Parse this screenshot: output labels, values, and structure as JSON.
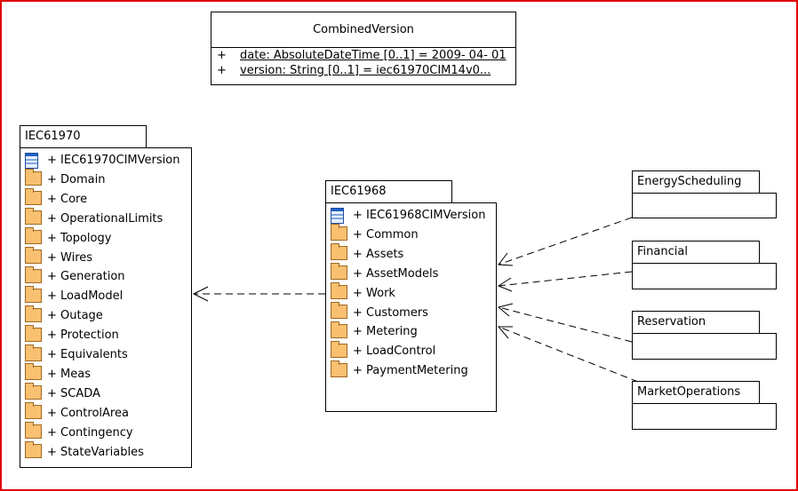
{
  "combined_version": {
    "title": "CombinedVersion",
    "attributes": [
      {
        "visibility": "+",
        "text": "date:  AbsoluteDateTime [0..1] = 2009- 04- 01"
      },
      {
        "visibility": "+",
        "text": "version:  String [0..1] = iec61970CIM14v0..."
      }
    ]
  },
  "iec61970": {
    "name": "IEC61970",
    "items": [
      {
        "label": "+ IEC61970CIMVersion",
        "icon": "class-icon"
      },
      {
        "label": "+ Domain",
        "icon": "folder-icon"
      },
      {
        "label": "+ Core",
        "icon": "folder-icon"
      },
      {
        "label": "+ OperationalLimits",
        "icon": "folder-icon"
      },
      {
        "label": "+ Topology",
        "icon": "folder-icon"
      },
      {
        "label": "+ Wires",
        "icon": "folder-icon"
      },
      {
        "label": "+ Generation",
        "icon": "folder-icon"
      },
      {
        "label": "+ LoadModel",
        "icon": "folder-icon"
      },
      {
        "label": "+ Outage",
        "icon": "folder-icon"
      },
      {
        "label": "+ Protection",
        "icon": "folder-icon"
      },
      {
        "label": "+ Equivalents",
        "icon": "folder-icon"
      },
      {
        "label": "+ Meas",
        "icon": "folder-icon"
      },
      {
        "label": "+ SCADA",
        "icon": "folder-icon"
      },
      {
        "label": "+ ControlArea",
        "icon": "folder-icon"
      },
      {
        "label": "+ Contingency",
        "icon": "folder-icon"
      },
      {
        "label": "+ StateVariables",
        "icon": "folder-icon"
      }
    ]
  },
  "iec61968": {
    "name": "IEC61968",
    "items": [
      {
        "label": "+ IEC61968CIMVersion",
        "icon": "class-icon"
      },
      {
        "label": "+ Common",
        "icon": "folder-icon"
      },
      {
        "label": "+ Assets",
        "icon": "folder-icon"
      },
      {
        "label": "+ AssetModels",
        "icon": "folder-icon"
      },
      {
        "label": "+ Work",
        "icon": "folder-icon"
      },
      {
        "label": "+ Customers",
        "icon": "folder-icon"
      },
      {
        "label": "+ Metering",
        "icon": "folder-icon"
      },
      {
        "label": "+ LoadControl",
        "icon": "folder-icon"
      },
      {
        "label": "+ PaymentMetering",
        "icon": "folder-icon"
      }
    ]
  },
  "packages": [
    {
      "name": "EnergyScheduling"
    },
    {
      "name": "Financial"
    },
    {
      "name": "Reservation"
    },
    {
      "name": "MarketOperations"
    }
  ],
  "colors": {
    "frame": "#e00000",
    "folder": "#f8c070"
  }
}
